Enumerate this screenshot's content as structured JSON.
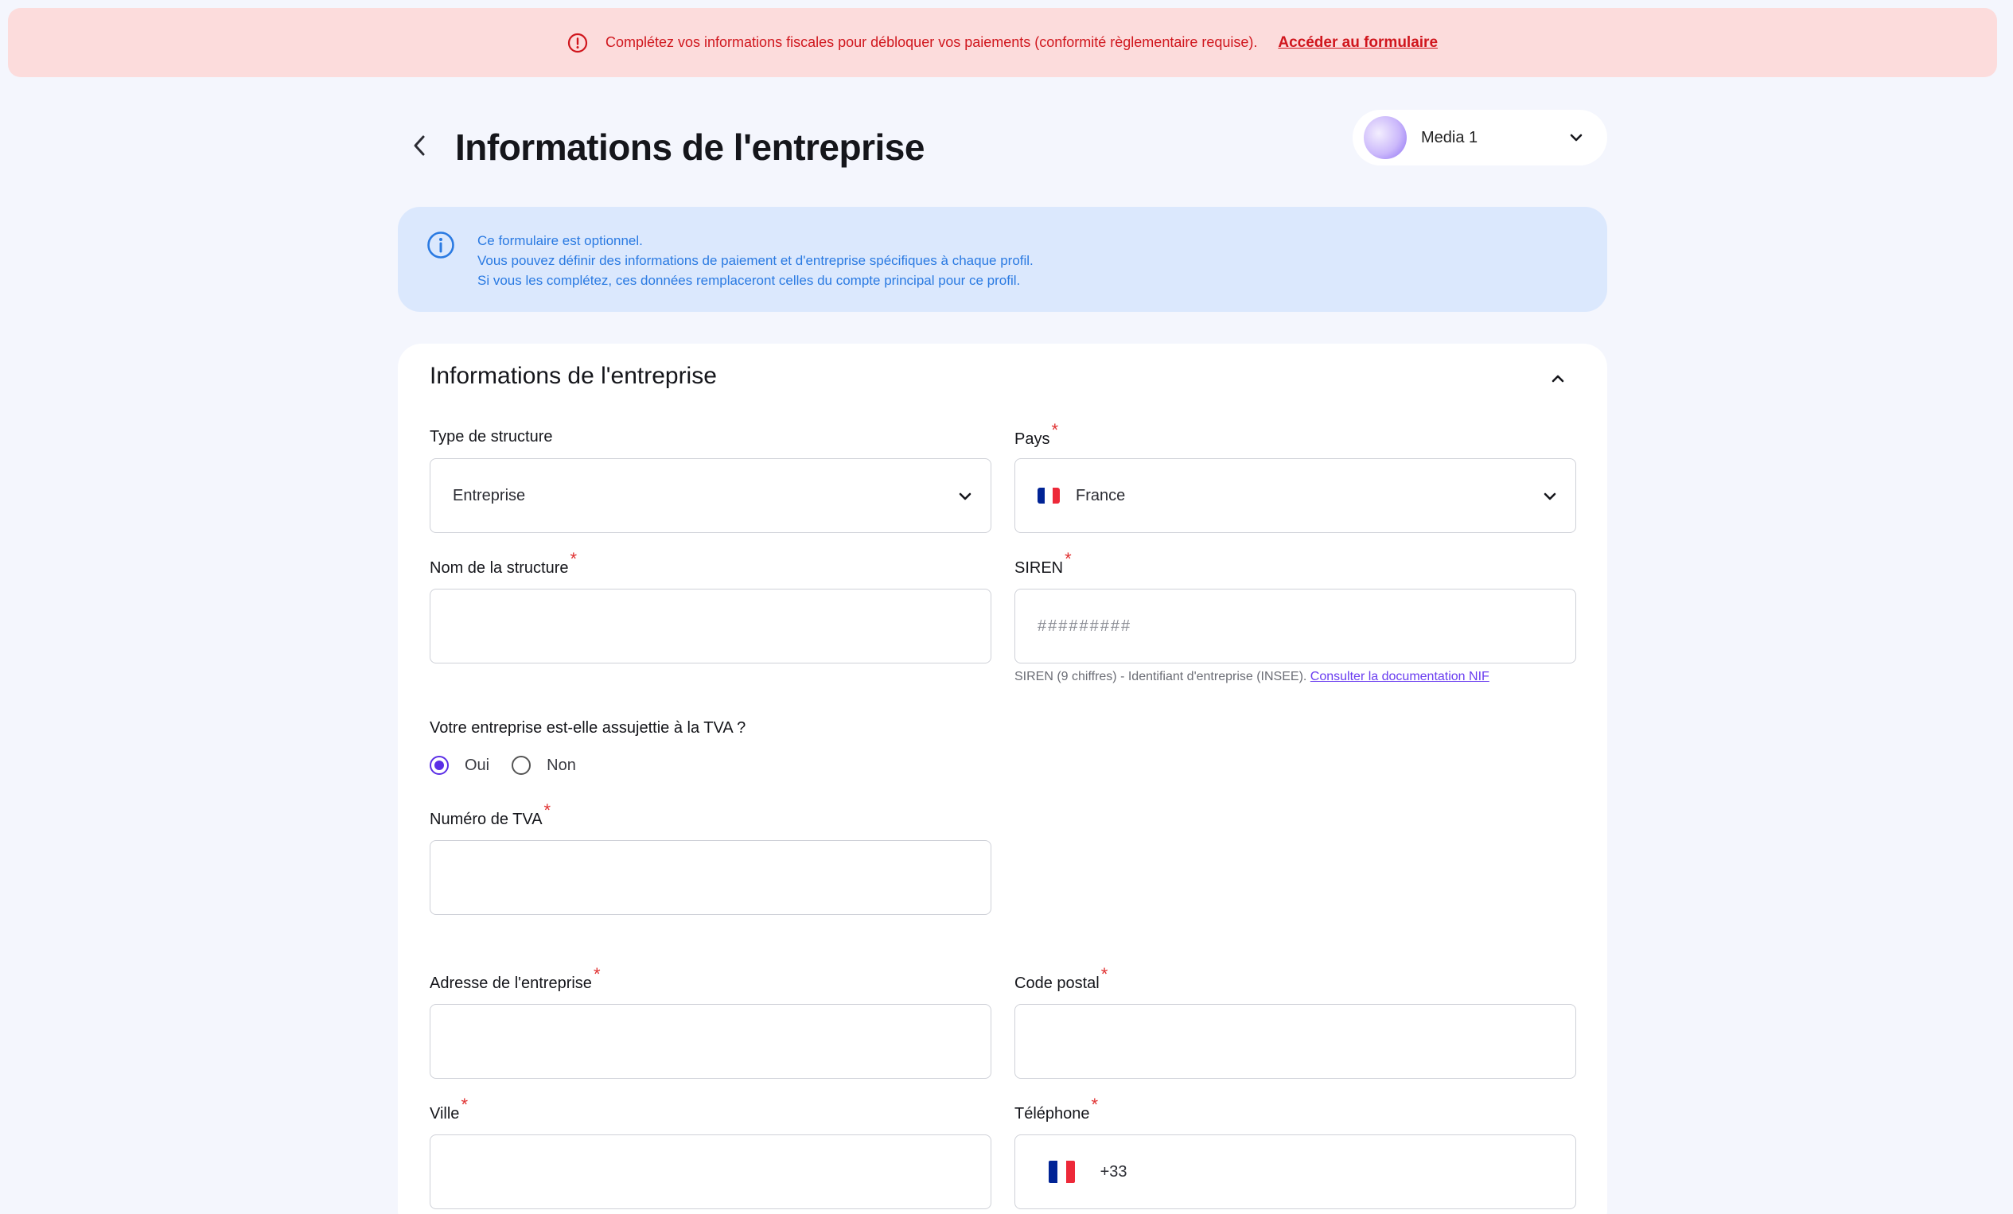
{
  "banner": {
    "message": "Complétez vos informations fiscales pour débloquer vos paiements (conformité règlementaire requise).",
    "link_label": "Accéder au formulaire",
    "icon": "alert-circle-icon",
    "color": "#d0161d"
  },
  "header": {
    "title": "Informations de l'entreprise",
    "back_icon": "chevron-left-icon"
  },
  "profile": {
    "name": "Media 1",
    "icon": "chevron-down-icon"
  },
  "info_box": {
    "lines": [
      "Ce formulaire est optionnel.",
      "Vous pouvez définir des informations de paiement et d'entreprise spécifiques à chaque profil.",
      "Si vous les complétez, ces données remplaceront celles du compte principal pour ce profil."
    ],
    "icon": "info-icon",
    "color": "#2a7ae2"
  },
  "form": {
    "section_title": "Informations de l'entreprise",
    "required_mark": "*",
    "structure_type": {
      "label": "Type de structure",
      "value": "Entreprise"
    },
    "country": {
      "label": "Pays",
      "value": "France"
    },
    "structure_name": {
      "label": "Nom de la structure",
      "value": ""
    },
    "siren": {
      "label": "SIREN",
      "placeholder": "#########",
      "help": "SIREN (9 chiffres) - Identifiant d'entreprise (INSEE).",
      "help_link": "Consulter la documentation NIF"
    },
    "vat_question": {
      "label": "Votre entreprise est-elle assujettie à la TVA ?",
      "options": [
        "Oui",
        "Non"
      ],
      "selected": "Oui"
    },
    "vat_number": {
      "label": "Numéro de TVA",
      "value": ""
    },
    "address": {
      "label": "Adresse de l'entreprise",
      "value": ""
    },
    "postal_code": {
      "label": "Code postal",
      "value": ""
    },
    "city": {
      "label": "Ville",
      "value": ""
    },
    "phone": {
      "label": "Téléphone",
      "prefix": "+33",
      "value": ""
    }
  },
  "colors": {
    "accent": "#5b2ee6",
    "required": "#e03131",
    "background": "#f4f6fd"
  }
}
